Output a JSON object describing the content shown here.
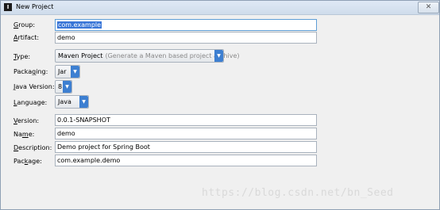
{
  "window": {
    "title": "New Project",
    "close_glyph": "✕"
  },
  "form": {
    "group": {
      "label_key": "G",
      "label_rest": "roup:",
      "value": "com.example"
    },
    "artifact": {
      "label_key": "A",
      "label_rest": "rtifact:",
      "value": "demo"
    },
    "type": {
      "label_key": "T",
      "label_rest": "ype:",
      "value": "Maven Project",
      "hint": "(Generate a Maven based project archive)"
    },
    "packaging": {
      "label_pre": "Packa",
      "label_key": "g",
      "label_rest": "ing:",
      "value": "Jar"
    },
    "java_version": {
      "label_key": "J",
      "label_rest": "ava Version:",
      "value": "8"
    },
    "language": {
      "label_key": "L",
      "label_rest": "anguage:",
      "value": "Java"
    },
    "version": {
      "label_key": "V",
      "label_rest": "ersion:",
      "value": "0.0.1-SNAPSHOT"
    },
    "name": {
      "label_pre": "Na",
      "label_key": "m",
      "label_rest": "e:",
      "value": "demo"
    },
    "description": {
      "label_key": "D",
      "label_rest": "escription:",
      "value": "Demo project for Spring Boot"
    },
    "package": {
      "label_pre": "Pac",
      "label_key": "k",
      "label_rest": "age:",
      "value": "com.example.demo"
    }
  },
  "watermark": "https://blog.csdn.net/bn_Seed",
  "colors": {
    "accent": "#3d7fd1",
    "selection": "#3875d7",
    "focus_border": "#5e9ed6"
  },
  "icons": {
    "app": "intellij-app-icon",
    "dropdown": "chevron-down-icon",
    "close": "close-icon"
  }
}
